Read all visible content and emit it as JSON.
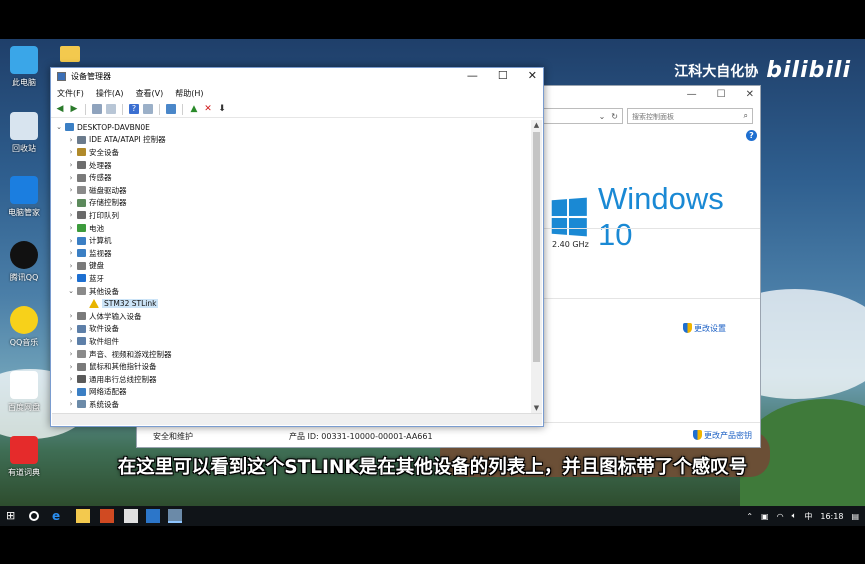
{
  "watermark": {
    "channel": "江科大自化协",
    "logo_text": "bilibili"
  },
  "desktop_icons": [
    {
      "label": "此电脑",
      "icon": "computer-icon",
      "color": "#3aa6e8"
    },
    {
      "label": "回收站",
      "icon": "recycle-bin-icon",
      "color": "#d8e4ef"
    },
    {
      "label": "电脑管家",
      "icon": "pc-manager-icon",
      "color": "#1b7ee0"
    },
    {
      "label": "腾讯QQ",
      "icon": "qq-icon",
      "color": "#111111"
    },
    {
      "label": "QQ音乐",
      "icon": "qq-music-icon",
      "color": "#f7d11a"
    },
    {
      "label": "百度网盘",
      "icon": "baidu-netdisk-icon",
      "color": "#ffffff"
    },
    {
      "label": "有道词典",
      "icon": "youdao-icon",
      "color": "#e52b2b"
    }
  ],
  "system_window": {
    "search_placeholder": "搜索控制面板",
    "help": "?",
    "os_logo_text": "Windows 10",
    "cpu_speed": "2.40 GHz",
    "change_settings": "更改设置",
    "section_security": "安全和维护",
    "product_id": "产品 ID: 00331-10000-00001-AA661",
    "change_key": "更改产品密钥"
  },
  "device_manager": {
    "title": "设备管理器",
    "menu": [
      "文件(F)",
      "操作(A)",
      "查看(V)",
      "帮助(H)"
    ],
    "root": "DESKTOP-DAVBN0E",
    "tree": [
      {
        "label": "IDE ATA/ATAPI 控制器",
        "icon": "ide-controller-icon",
        "color": "#6b7b8c",
        "expanded": false,
        "level": 1
      },
      {
        "label": "安全设备",
        "icon": "security-device-icon",
        "color": "#b08a2a",
        "expanded": false,
        "level": 1
      },
      {
        "label": "处理器",
        "icon": "processor-icon",
        "color": "#6d6d6d",
        "expanded": false,
        "level": 1
      },
      {
        "label": "传感器",
        "icon": "sensor-icon",
        "color": "#7a7a7a",
        "expanded": false,
        "level": 1
      },
      {
        "label": "磁盘驱动器",
        "icon": "disk-drive-icon",
        "color": "#8a8a8a",
        "expanded": false,
        "level": 1
      },
      {
        "label": "存储控制器",
        "icon": "storage-controller-icon",
        "color": "#5c8a5c",
        "expanded": false,
        "level": 1
      },
      {
        "label": "打印队列",
        "icon": "printer-icon",
        "color": "#6a6a6a",
        "expanded": false,
        "level": 1
      },
      {
        "label": "电池",
        "icon": "battery-icon",
        "color": "#3c9b3c",
        "expanded": false,
        "level": 1
      },
      {
        "label": "计算机",
        "icon": "computer-icon",
        "color": "#3b7fc4",
        "expanded": false,
        "level": 1
      },
      {
        "label": "监视器",
        "icon": "monitor-icon",
        "color": "#3b7fc4",
        "expanded": false,
        "level": 1
      },
      {
        "label": "键盘",
        "icon": "keyboard-icon",
        "color": "#7a7a7a",
        "expanded": false,
        "level": 1
      },
      {
        "label": "蓝牙",
        "icon": "bluetooth-icon",
        "color": "#1d6fd1",
        "expanded": false,
        "level": 1
      },
      {
        "label": "其他设备",
        "icon": "other-devices-icon",
        "color": "#8a8a8a",
        "expanded": true,
        "level": 1
      },
      {
        "label": "STM32 STLink",
        "icon": "warning-device-icon",
        "color": "#e8b400",
        "expanded": null,
        "level": 2,
        "selected": true
      },
      {
        "label": "人体学输入设备",
        "icon": "hid-icon",
        "color": "#7a7a7a",
        "expanded": false,
        "level": 1
      },
      {
        "label": "软件设备",
        "icon": "software-device-icon",
        "color": "#5d7fa8",
        "expanded": false,
        "level": 1
      },
      {
        "label": "软件组件",
        "icon": "software-component-icon",
        "color": "#5d7fa8",
        "expanded": false,
        "level": 1
      },
      {
        "label": "声音、视频和游戏控制器",
        "icon": "sound-icon",
        "color": "#8a8a8a",
        "expanded": false,
        "level": 1
      },
      {
        "label": "鼠标和其他指针设备",
        "icon": "mouse-icon",
        "color": "#7a7a7a",
        "expanded": false,
        "level": 1
      },
      {
        "label": "通用串行总线控制器",
        "icon": "usb-icon",
        "color": "#5a5a5a",
        "expanded": false,
        "level": 1
      },
      {
        "label": "网络适配器",
        "icon": "network-adapter-icon",
        "color": "#3b7fc4",
        "expanded": false,
        "level": 1
      },
      {
        "label": "系统设备",
        "icon": "system-device-icon",
        "color": "#6b8aa8",
        "expanded": false,
        "level": 1
      }
    ]
  },
  "subtitle": "在这里可以看到这个STLINK是在其他设备的列表上，并且图标带了个感叹号",
  "taskbar": {
    "tray_ime": "中",
    "time": "16:18"
  }
}
